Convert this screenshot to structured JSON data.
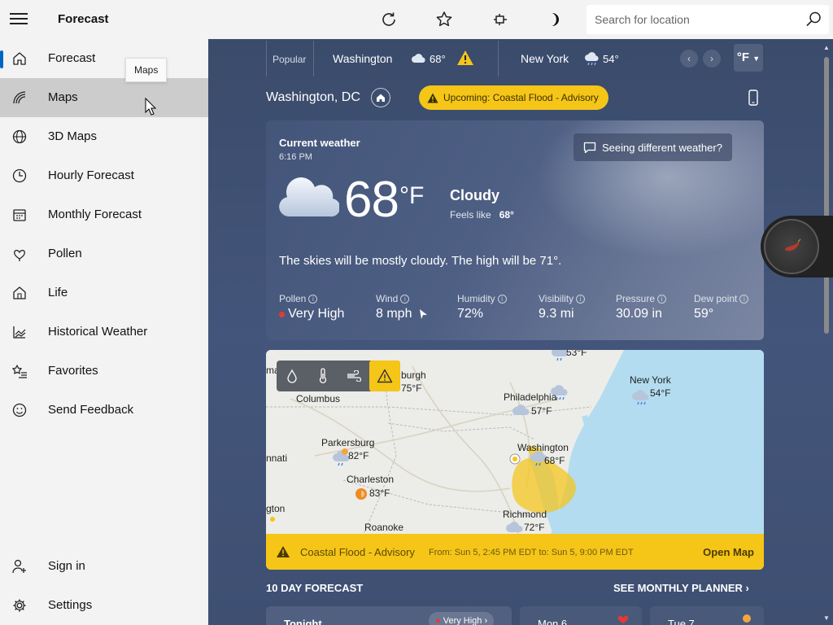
{
  "app": {
    "title": "Forecast"
  },
  "toolbar": {
    "refresh_icon": "refresh-icon",
    "favorite_icon": "star-icon",
    "pin_icon": "pin-icon",
    "theme_icon": "moon-icon"
  },
  "search": {
    "placeholder": "Search for location",
    "value": ""
  },
  "sidebar": {
    "items": [
      {
        "label": "Forecast",
        "icon": "home-icon"
      },
      {
        "label": "Maps",
        "icon": "maps-icon"
      },
      {
        "label": "3D Maps",
        "icon": "globe-icon"
      },
      {
        "label": "Hourly Forecast",
        "icon": "clock-icon"
      },
      {
        "label": "Monthly Forecast",
        "icon": "calendar-icon"
      },
      {
        "label": "Pollen",
        "icon": "pollen-icon"
      },
      {
        "label": "Life",
        "icon": "life-icon"
      },
      {
        "label": "Historical Weather",
        "icon": "chart-icon"
      },
      {
        "label": "Favorites",
        "icon": "star-list-icon"
      },
      {
        "label": "Send Feedback",
        "icon": "smiley-icon"
      }
    ],
    "bottom": [
      {
        "label": "Sign in",
        "icon": "person-add-icon"
      },
      {
        "label": "Settings",
        "icon": "gear-icon"
      }
    ],
    "tooltip": "Maps"
  },
  "favorites": {
    "popular_label": "Popular",
    "items": [
      {
        "city": "Washington",
        "temp": "68°"
      },
      {
        "city": "New York",
        "temp": "54°"
      }
    ],
    "unit": "°F"
  },
  "location": {
    "name": "Washington, DC",
    "alert": "Upcoming: Coastal Flood - Advisory"
  },
  "current": {
    "title": "Current weather",
    "time": "6:16 PM",
    "feedback": "Seeing different weather?",
    "temp": "68",
    "unit": "°F",
    "condition": "Cloudy",
    "feels_label": "Feels like",
    "feels_value": "68°",
    "summary": "The skies will be mostly cloudy. The high will be 71°.",
    "metrics": [
      {
        "label": "Pollen",
        "value": "Very High"
      },
      {
        "label": "Wind",
        "value": "8 mph"
      },
      {
        "label": "Humidity",
        "value": "72%"
      },
      {
        "label": "Visibility",
        "value": "9.3 mi"
      },
      {
        "label": "Pressure",
        "value": "30.09 in"
      },
      {
        "label": "Dew point",
        "value": "59°"
      }
    ]
  },
  "map": {
    "places": [
      {
        "name": "ma",
        "temp": ""
      },
      {
        "name": "burgh",
        "temp": "75°F"
      },
      {
        "name": "Columbus",
        "temp": ""
      },
      {
        "name": "Philadelphia",
        "temp": "57°F"
      },
      {
        "name": "New York",
        "temp": "54°F"
      },
      {
        "name": "Parkersburg",
        "temp": "82°F"
      },
      {
        "name": "nnati",
        "temp": ""
      },
      {
        "name": "Washington",
        "temp": "68°F"
      },
      {
        "name": "Charleston",
        "temp": "83°F"
      },
      {
        "name": "gton",
        "temp": ""
      },
      {
        "name": "Richmond",
        "temp": "72°F"
      },
      {
        "name": "Roanoke",
        "temp": ""
      }
    ],
    "top_temp": "53°F",
    "layers": [
      "precipitation-icon",
      "temperature-icon",
      "wind-icon",
      "warning-icon"
    ],
    "advisory": {
      "title": "Coastal Flood - Advisory",
      "time": "From: Sun 5, 2:45 PM EDT to: Sun 5, 9:00 PM EDT",
      "action": "Open Map"
    }
  },
  "forecast": {
    "heading": "10 DAY FORECAST",
    "monthly": "SEE MONTHLY PLANNER",
    "cards": [
      {
        "day": "Tonight",
        "pill": "Very High"
      },
      {
        "day": "Mon 6",
        "pill": ""
      },
      {
        "day": "Tue 7",
        "pill": ""
      }
    ]
  },
  "colors": {
    "accent": "#0067c0",
    "alert": "#f5c518",
    "main_bg": "#3e4f72"
  }
}
